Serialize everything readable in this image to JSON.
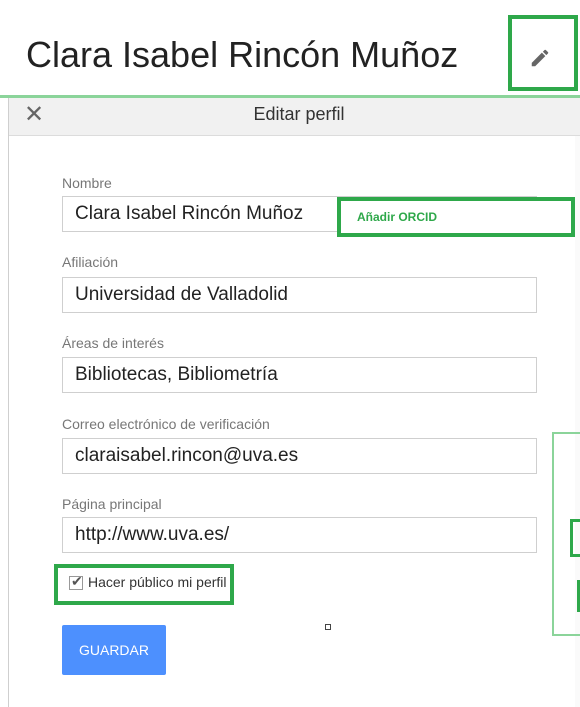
{
  "header": {
    "name": "Clara Isabel Rincón Muñoz",
    "edit_icon": "pencil-icon"
  },
  "dialog": {
    "title": "Editar perfil",
    "close_icon": "close-icon",
    "fields": {
      "name_label": "Nombre",
      "name_value": "Clara Isabel Rincón Muñoz",
      "orcid_link": "Añadir ORCID",
      "affiliation_label": "Afiliación",
      "affiliation_value": "Universidad de Valladolid",
      "interests_label": "Áreas de interés",
      "interests_value": "Bibliotecas, Bibliometría",
      "email_label": "Correo electrónico de verificación",
      "email_value": "claraisabel.rincon@uva.es",
      "homepage_label": "Página principal",
      "homepage_value": "http://www.uva.es/"
    },
    "public_profile": {
      "label": "Hacer público mi perfil",
      "checked": true
    },
    "save_label": "GUARDAR"
  },
  "colors": {
    "highlight": "#2ea84a",
    "save_button": "#4d90fe"
  }
}
